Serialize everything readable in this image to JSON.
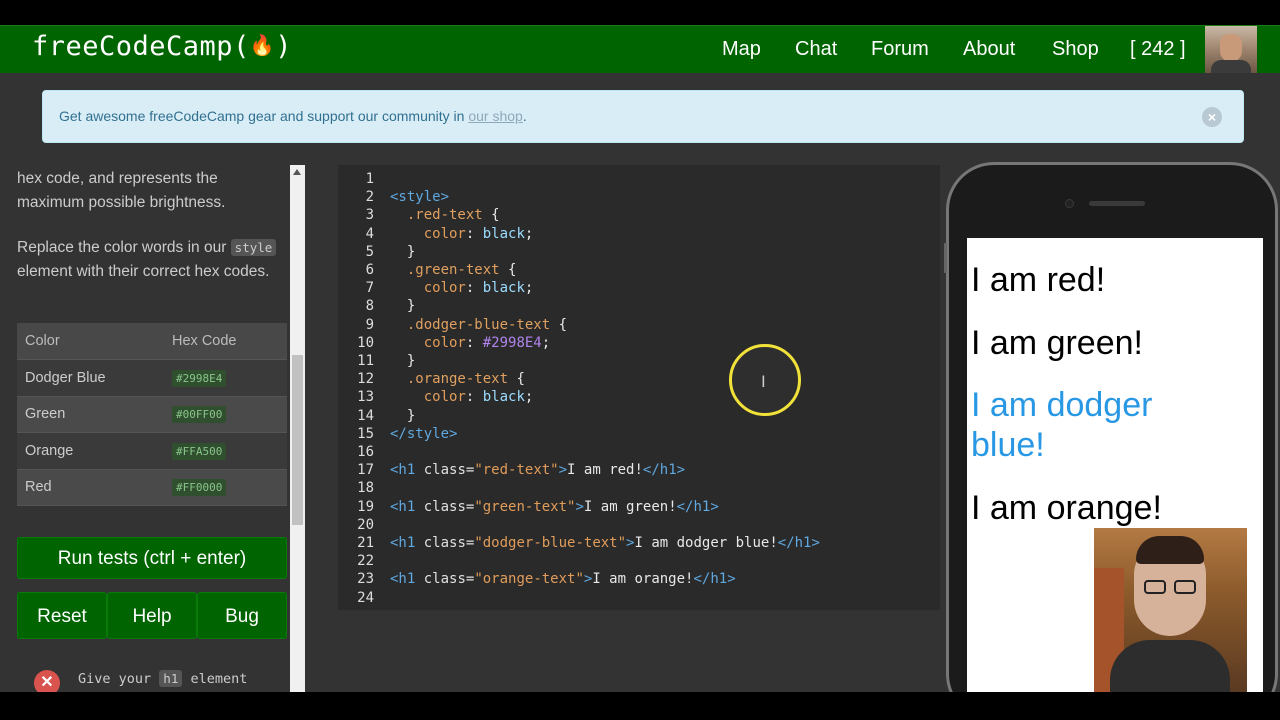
{
  "navbar": {
    "logo": "freeCodeCamp(",
    "logo_end": ")",
    "links": [
      "Map",
      "Chat",
      "Forum",
      "About",
      "Shop"
    ],
    "points": "[ 242 ]"
  },
  "banner": {
    "text": "Get awesome freeCodeCamp gear and support our community in ",
    "link": "our shop",
    "suffix": "."
  },
  "instructions": {
    "p1": "hex code, and represents the maximum possible brightness.",
    "p2_before": "Replace the color words in our",
    "p2_code": "style",
    "p2_after": "element with their correct hex codes."
  },
  "table": {
    "headers": [
      "Color",
      "Hex Code"
    ],
    "rows": [
      {
        "color": "Dodger Blue",
        "hex": "#2998E4"
      },
      {
        "color": "Green",
        "hex": "#00FF00"
      },
      {
        "color": "Orange",
        "hex": "#FFA500"
      },
      {
        "color": "Red",
        "hex": "#FF0000"
      }
    ]
  },
  "buttons": {
    "run": "Run tests (ctrl + enter)",
    "reset": "Reset",
    "help": "Help",
    "bug": "Bug"
  },
  "test": {
    "prefix": "Give your",
    "code": "h1",
    "suffix": "element"
  },
  "editor": {
    "line_numbers": [
      "1",
      "2",
      "3",
      "4",
      "5",
      "6",
      "7",
      "8",
      "9",
      "10",
      "11",
      "12",
      "13",
      "14",
      "15",
      "16",
      "17",
      "18",
      "19",
      "20",
      "21",
      "22",
      "23",
      "24"
    ],
    "lines": [
      "",
      "<style>",
      "  .red-text {",
      "    color: black;",
      "  }",
      "  .green-text {",
      "    color: black;",
      "  }",
      "  .dodger-blue-text {",
      "    color: #2998E4;",
      "  }",
      "  .orange-text {",
      "    color: black;",
      "  }",
      "</style>",
      "",
      "<h1 class=\"red-text\">I am red!</h1>",
      "",
      "<h1 class=\"green-text\">I am green!</h1>",
      "",
      "<h1 class=\"dodger-blue-text\">I am dodger blue!</h1>",
      "",
      "<h1 class=\"orange-text\">I am orange!</h1>",
      ""
    ]
  },
  "preview": {
    "h1_red": "I am red!",
    "h1_green": "I am green!",
    "h1_blue": "I am dodger blue!",
    "h1_orange": "I am orange!",
    "colors": {
      "red": "#000000",
      "green": "#000000",
      "blue": "#2998E4",
      "orange": "#000000"
    }
  },
  "colors": {
    "nav_green": "#006400",
    "banner_bg": "#d9edf7",
    "highlight_ring": "#f1e23a"
  }
}
